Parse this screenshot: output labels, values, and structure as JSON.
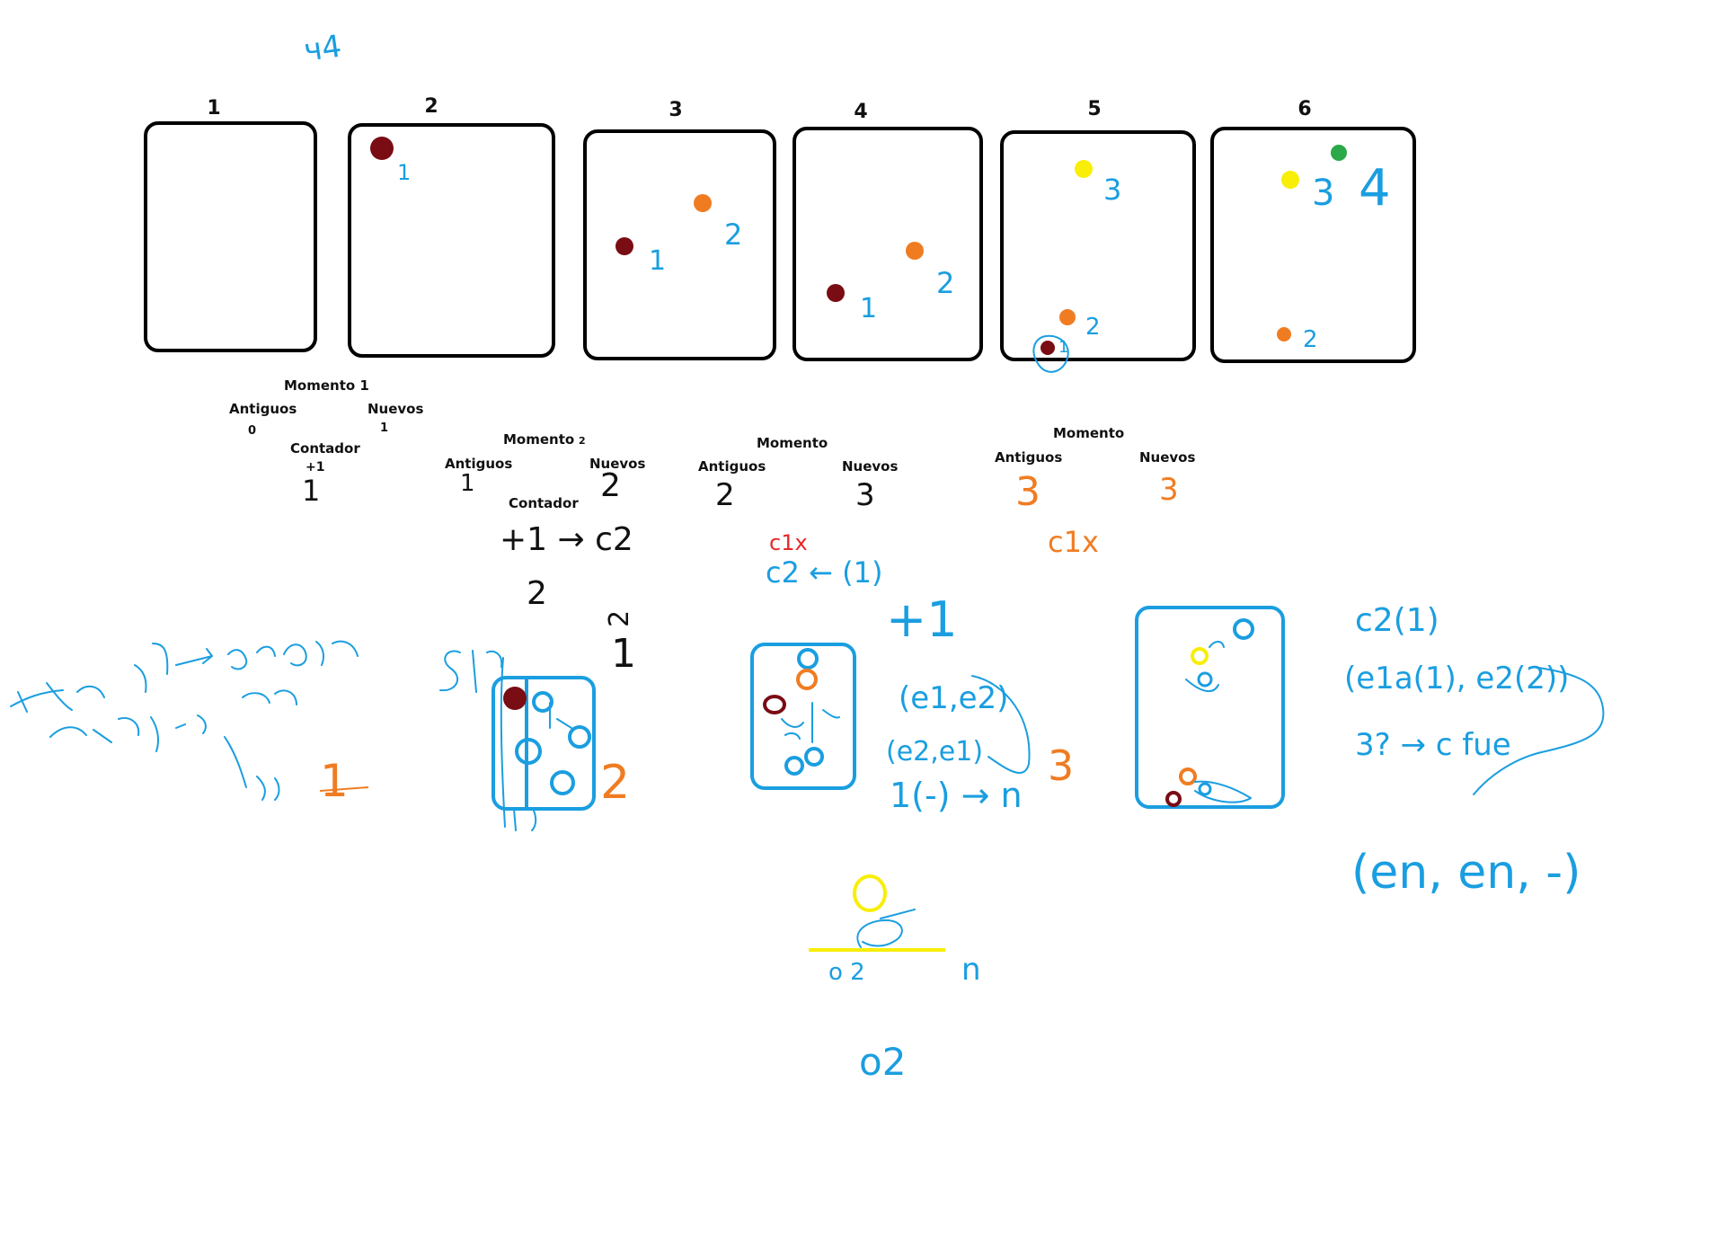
{
  "colors": {
    "ink": "#111111",
    "blue": "#1a9ee0",
    "orange": "#f07c22",
    "red": "#e8282a",
    "darkred": "#7a0c14",
    "yellow": "#f8ee08",
    "green": "#2ba84a"
  },
  "frames": [
    {
      "label": "1"
    },
    {
      "label": "2",
      "dots": [
        {
          "color": "darkred",
          "tag": "1"
        }
      ]
    },
    {
      "label": "3",
      "dots": [
        {
          "color": "darkred",
          "tag": "1"
        },
        {
          "color": "orange",
          "tag": "2"
        }
      ]
    },
    {
      "label": "4",
      "dots": [
        {
          "color": "darkred",
          "tag": "1"
        },
        {
          "color": "orange",
          "tag": "2"
        }
      ]
    },
    {
      "label": "5",
      "dots": [
        {
          "color": "yellow",
          "tag": "3"
        },
        {
          "color": "orange",
          "tag": "2"
        },
        {
          "color": "darkred",
          "tag": "1"
        }
      ]
    },
    {
      "label": "6",
      "dots": [
        {
          "color": "green",
          "tag": "4"
        },
        {
          "color": "yellow",
          "tag": "3"
        },
        {
          "color": "orange",
          "tag": "2"
        }
      ]
    }
  ],
  "moments": [
    {
      "title": "Momento 1",
      "old_label": "Antiguos",
      "old_value": "0",
      "new_label": "Nuevos",
      "new_value": "1",
      "counter_label": "Contador",
      "counter_value": "+1",
      "written": "1"
    },
    {
      "title": "Momento",
      "title_suffix": "2",
      "old_label": "Antiguos",
      "old_value": "1",
      "new_label": "Nuevos",
      "new_value": "2",
      "counter_label": "Contador",
      "counter_expr": "+1 → c2",
      "written": "2"
    },
    {
      "title": "Momento",
      "old_label": "Antiguos",
      "old_value": "2",
      "new_label": "Nuevos",
      "new_value": "3"
    },
    {
      "title": "Momento",
      "old_label": "Antiguos",
      "old_value": "3",
      "new_label": "Nuevos",
      "new_value": "3"
    }
  ],
  "scribbles": {
    "top_left": "ч4",
    "left_note_number": "1",
    "frame2_number": "2",
    "vertical_numbers": [
      "2",
      "1"
    ],
    "c1x_red": "c1x",
    "c1x_orange": "c1x",
    "c2_from_1": "c2 ← (1)",
    "plus1": "+1",
    "pair_e1e2": "(e1,e2)",
    "pair_e2e1": "(e2,e1)",
    "lower_expr": "1(-) → n",
    "three": "3",
    "right_c21": "c2(1)",
    "right_pair": "(e1a(1), e2(2))",
    "right_arrow": "3? → c fue",
    "right_tuple": "(en, en, -)",
    "bottom_o2": "o2",
    "bottom_o2_small": "o 2",
    "yellow_n": "n"
  }
}
